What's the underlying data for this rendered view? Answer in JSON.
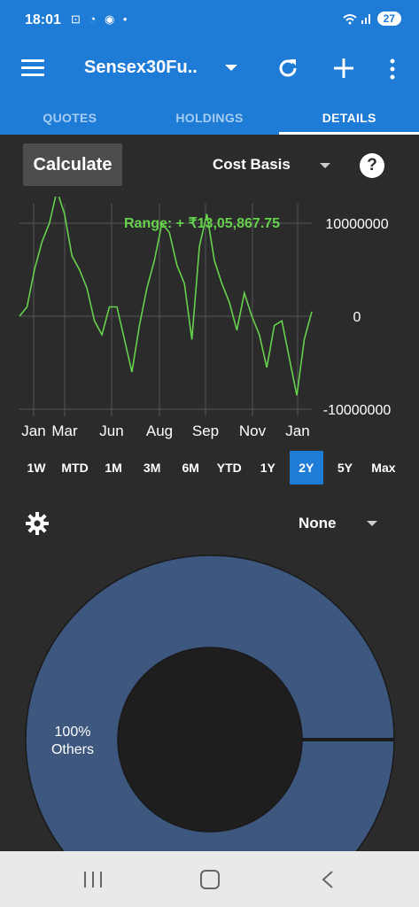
{
  "status": {
    "time": "18:01",
    "left_icons": "⊡ ◔ ◉ •",
    "battery": "27",
    "signal_icons": "📶"
  },
  "appbar": {
    "title": "Sensex30Fu..",
    "icons": [
      "menu-icon",
      "chevron-down-icon",
      "refresh-icon",
      "add-icon",
      "more-vert-icon"
    ]
  },
  "tabs": [
    {
      "label": "QUOTES"
    },
    {
      "label": "HOLDINGS"
    },
    {
      "label": "DETAILS"
    }
  ],
  "controls": {
    "calculate_label": "Calculate",
    "basis_label": "Cost Basis",
    "help_label": "?"
  },
  "chart_data": {
    "type": "line",
    "title": "",
    "annotation": "Range: + ₹13,05,867.75",
    "x_tick_labels": [
      "Jan",
      "Mar",
      "Jun",
      "Aug",
      "Sep",
      "Nov",
      "Jan"
    ],
    "y_tick_labels": [
      "10000000",
      "0",
      "-10000000"
    ],
    "ylim": [
      -10000000,
      10000000
    ],
    "grid": true,
    "color": "#66d14c",
    "series": [
      {
        "values": [
          0,
          1000000,
          5000000,
          8000000,
          10000000,
          13500000,
          11000000,
          6500000,
          5000000,
          3000000,
          -500000,
          -2000000,
          1000000,
          1000000,
          -2500000,
          -6000000,
          -1000000,
          3000000,
          6000000,
          10000000,
          9000000,
          5500000,
          3500000,
          -2500000,
          7500000,
          11000000,
          6000000,
          3500000,
          1500000,
          -1500000,
          2500000,
          0,
          -2000000,
          -5500000,
          -1000000,
          -500000,
          -4500000,
          -8500000,
          -2500000,
          500000
        ]
      }
    ]
  },
  "periods": [
    {
      "label": "1W"
    },
    {
      "label": "MTD"
    },
    {
      "label": "1M"
    },
    {
      "label": "3M"
    },
    {
      "label": "6M"
    },
    {
      "label": "YTD"
    },
    {
      "label": "1Y"
    },
    {
      "label": "2Y",
      "active": true
    },
    {
      "label": "5Y"
    },
    {
      "label": "Max"
    }
  ],
  "allocation": {
    "group_label": "None",
    "slices": [
      {
        "label": "100%\nOthers",
        "percent": "100%",
        "name": "Others",
        "color": "#3d577f"
      }
    ]
  }
}
